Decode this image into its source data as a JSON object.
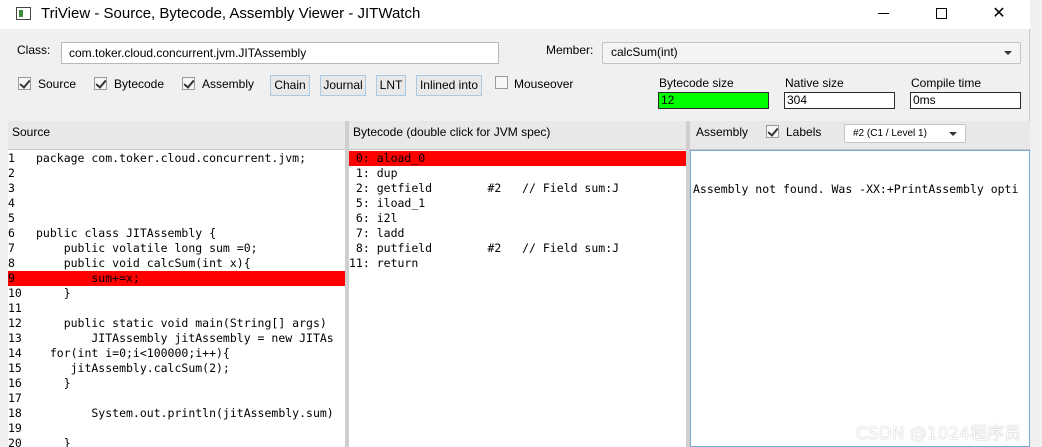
{
  "window": {
    "title": "TriView - Source, Bytecode, Assembly Viewer - JITWatch"
  },
  "controls": {
    "class_label": "Class:",
    "class_value": "com.toker.cloud.concurrent.jvm.JITAssembly",
    "member_label": "Member:",
    "member_value": "calcSum(int)",
    "checkboxes": [
      {
        "label": "Source",
        "checked": true
      },
      {
        "label": "Bytecode",
        "checked": true
      },
      {
        "label": "Assembly",
        "checked": true
      }
    ],
    "buttons": [
      "Chain",
      "Journal",
      "LNT",
      "Inlined into"
    ],
    "mouseover_label": "Mouseover",
    "stats": {
      "bytecode_size_label": "Bytecode size",
      "bytecode_size_value": "12",
      "native_size_label": "Native size",
      "native_size_value": "304",
      "compile_time_label": "Compile time",
      "compile_time_value": "0ms"
    },
    "colors": {
      "highlight": "#ff0000",
      "bytecode_size_bg": "#00ff00",
      "button_border": "#a9c9e4"
    }
  },
  "source_panel": {
    "title": "Source",
    "lines": [
      {
        "num": "1",
        "text": "package com.toker.cloud.concurrent.jvm;"
      },
      {
        "num": "2",
        "text": ""
      },
      {
        "num": "3",
        "text": ""
      },
      {
        "num": "4",
        "text": ""
      },
      {
        "num": "5",
        "text": ""
      },
      {
        "num": "6",
        "text": "public class JITAssembly {"
      },
      {
        "num": "7",
        "text": "    public volatile long sum =0;"
      },
      {
        "num": "8",
        "text": "    public void calcSum(int x){"
      },
      {
        "num": "9",
        "text": "        sum+=x;",
        "highlight": true
      },
      {
        "num": "10",
        "text": "    }"
      },
      {
        "num": "11",
        "text": ""
      },
      {
        "num": "12",
        "text": "    public static void main(String[] args)"
      },
      {
        "num": "13",
        "text": "        JITAssembly jitAssembly = new JITAs"
      },
      {
        "num": "14",
        "text": "  for(int i=0;i<100000;i++){"
      },
      {
        "num": "15",
        "text": "     jitAssembly.calcSum(2);"
      },
      {
        "num": "16",
        "text": "    }"
      },
      {
        "num": "17",
        "text": ""
      },
      {
        "num": "18",
        "text": "        System.out.println(jitAssembly.sum)"
      },
      {
        "num": "19",
        "text": ""
      },
      {
        "num": "20",
        "text": "    }"
      }
    ]
  },
  "bytecode_panel": {
    "title": "Bytecode (double click for JVM spec)",
    "lines": [
      {
        "num": " 0:",
        "text": "aload_0",
        "highlight": true
      },
      {
        "num": " 1:",
        "text": "dup"
      },
      {
        "num": " 2:",
        "text": "getfield        #2   // Field sum:J"
      },
      {
        "num": " 5:",
        "text": "iload_1"
      },
      {
        "num": " 6:",
        "text": "i2l"
      },
      {
        "num": " 7:",
        "text": "ladd"
      },
      {
        "num": " 8:",
        "text": "putfield        #2   // Field sum:J"
      },
      {
        "num": "11:",
        "text": "return"
      }
    ]
  },
  "assembly_panel": {
    "title": "Assembly",
    "labels_checkbox": "Labels",
    "labels_checked": true,
    "level_value": "#2  (C1 / Level 1)",
    "message": "Assembly not found. Was -XX:+PrintAssembly opti"
  },
  "watermark": "CSDN @1024程序员"
}
